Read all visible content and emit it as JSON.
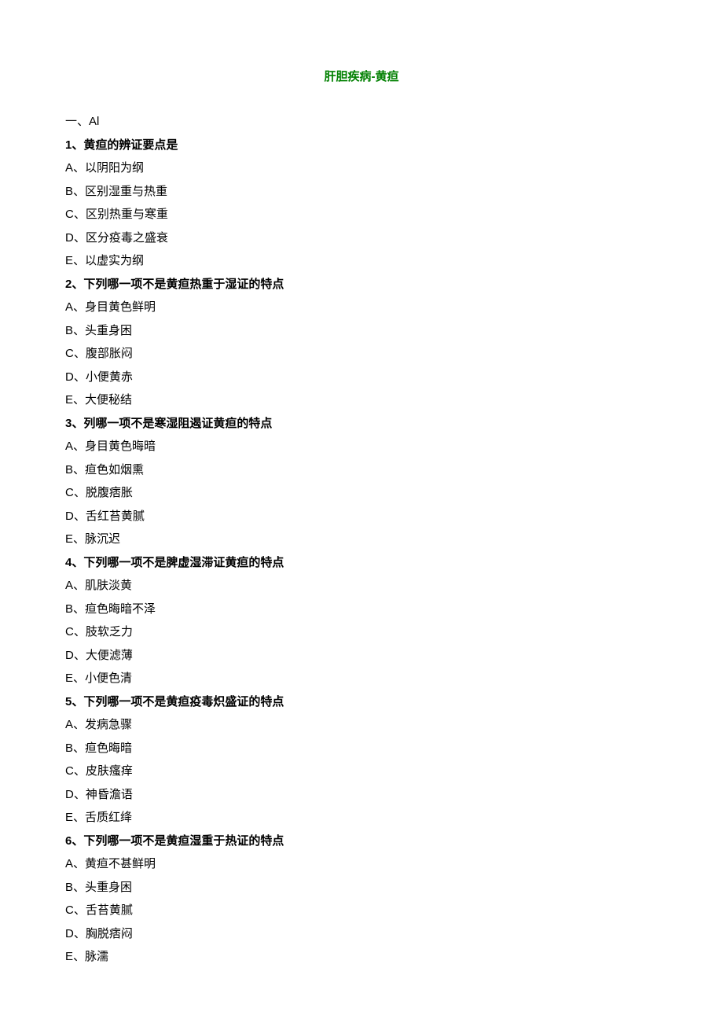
{
  "title": "肝胆疾病-黄疸",
  "section": "一、Al",
  "questions": [
    {
      "stem": "1、黄疸的辨证要点是",
      "options": [
        "A、以阴阳为纲",
        "B、区别湿重与热重",
        "C、区别热重与寒重",
        "D、区分疫毒之盛衰",
        "E、以虚实为纲"
      ]
    },
    {
      "stem": "2、下列哪一项不是黄疸热重于湿证的特点",
      "options": [
        "A、身目黄色鲜明",
        "B、头重身困",
        "C、腹部胀闷",
        "D、小便黄赤",
        "E、大便秘结"
      ]
    },
    {
      "stem": "3、列哪一项不是寒湿阻遏证黄疸的特点",
      "options": [
        "A、身目黄色晦暗",
        "B、疸色如烟熏",
        "C、脱腹痞胀",
        "D、舌红苔黄腻",
        "E、脉沉迟"
      ]
    },
    {
      "stem": "4、下列哪一项不是脾虚湿滞证黄疸的特点",
      "options": [
        "A、肌肤淡黄",
        "B、疸色晦暗不泽",
        "C、肢软乏力",
        "D、大便滤薄",
        "E、小便色清"
      ]
    },
    {
      "stem": "5、下列哪一项不是黄疸疫毒炽盛证的特点",
      "options": [
        "A、发病急骤",
        "B、疸色晦暗",
        "C、皮肤瘙痒",
        "D、神昏澹语",
        "E、舌质红绛"
      ]
    },
    {
      "stem": "6、下列哪一项不是黄疸湿重于热证的特点",
      "options": [
        "A、黄疸不甚鲜明",
        "B、头重身困",
        "C、舌苔黄腻",
        "D、胸脱痞闷",
        "E、脉濡"
      ]
    }
  ]
}
